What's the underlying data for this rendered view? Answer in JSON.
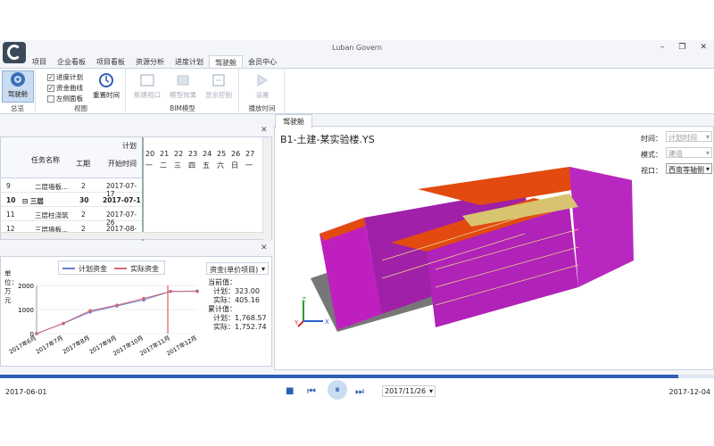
{
  "app": {
    "title": "Luban Govern"
  },
  "window_buttons": [
    "–",
    "❐",
    "✕"
  ],
  "menu": {
    "items": [
      "项目",
      "企业看板",
      "项目看板",
      "资源分析",
      "进度计划",
      "驾驶舱",
      "会员中心"
    ],
    "active": "驾驶舱"
  },
  "ribbon": {
    "groups": [
      {
        "label": "总览",
        "buttons": [
          {
            "label": "驾驶舱",
            "icon": "steering-wheel-icon",
            "active": true
          }
        ]
      },
      {
        "label": "视图",
        "checks": [
          {
            "label": "进度计划",
            "checked": true
          },
          {
            "label": "资金曲线",
            "checked": true
          },
          {
            "label": "左侧面板",
            "checked": false
          }
        ],
        "buttons": [
          {
            "label": "重置时间",
            "icon": "reset-time-icon"
          }
        ]
      },
      {
        "label": "BIM模型",
        "buttons": [
          {
            "label": "新建视口",
            "icon": "new-viewport-icon",
            "disabled": true
          },
          {
            "label": "模型效果",
            "icon": "model-effect-icon",
            "disabled": true
          },
          {
            "label": "显示控制",
            "icon": "display-control-icon",
            "disabled": true
          }
        ]
      },
      {
        "label": "播放时间",
        "buttons": [
          {
            "label": "设置",
            "icon": "settings-icon",
            "disabled": true
          }
        ]
      }
    ]
  },
  "grid": {
    "headers": {
      "name": "任务名称",
      "duration": "工期",
      "start": "开始时间",
      "group": "计划"
    },
    "day_numbers": [
      "20",
      "21",
      "22",
      "23",
      "24",
      "25",
      "26",
      "27"
    ],
    "weekdays": [
      "一",
      "二",
      "三",
      "四",
      "五",
      "六",
      "日",
      "一"
    ],
    "rows": [
      {
        "num": "9",
        "name": "二层墙板...",
        "duration": "2",
        "start": "2017-07-17",
        "bold": false
      },
      {
        "num": "10",
        "name": "⊟ 三层",
        "duration": "30",
        "start": "2017-07-1",
        "bold": true
      },
      {
        "num": "11",
        "name": "三层柱浇筑",
        "duration": "2",
        "start": "2017-07-26",
        "bold": false
      },
      {
        "num": "12",
        "name": "三层墙板...",
        "duration": "2",
        "start": "2017-08-08",
        "bold": false
      }
    ]
  },
  "fund_chart": {
    "ylabel": "单位：万元",
    "legend": [
      "计划资金",
      "实际资金"
    ],
    "dropdown": "资金(单价项目)",
    "current_label": "当前值：",
    "current_plan": "计划：323.00",
    "current_actual": "实际：405.16",
    "cumulative_label": "累计值：",
    "cumulative_plan": "计划：1,768.57",
    "cumulative_actual": "实际：1,752.74",
    "colors": {
      "plan": "#6a7fd0",
      "actual": "#d06a7a"
    }
  },
  "chart_data": {
    "type": "line",
    "categories": [
      "2017年6月",
      "2017年7月",
      "2017年8月",
      "2017年9月",
      "2017年10月",
      "2017年11月",
      "2017年12月"
    ],
    "series": [
      {
        "name": "计划资金",
        "values": [
          0,
          420,
          900,
          1150,
          1400,
          1750,
          1769
        ]
      },
      {
        "name": "实际资金",
        "values": [
          0,
          430,
          950,
          1180,
          1460,
          1752,
          1753
        ]
      }
    ],
    "yticks": [
      0,
      1000,
      2000
    ],
    "ylim": [
      0,
      2000
    ],
    "ylabel": "单位：万元"
  },
  "viewer": {
    "tab": "驾驶舱",
    "model_name": "B1-土建-某实验楼.YS",
    "time_label": "时间：",
    "time_value": "计划时间",
    "mode_label": "模式：",
    "mode_value": "建造",
    "view_label": "视口：",
    "view_value": "西南等轴侧",
    "axis": {
      "x": "X",
      "y": "Y",
      "z": "Z"
    }
  },
  "timeline": {
    "start": "2017-06-01",
    "end": "2017-12-04",
    "current": "2017/11/26",
    "progress": 0.95
  }
}
